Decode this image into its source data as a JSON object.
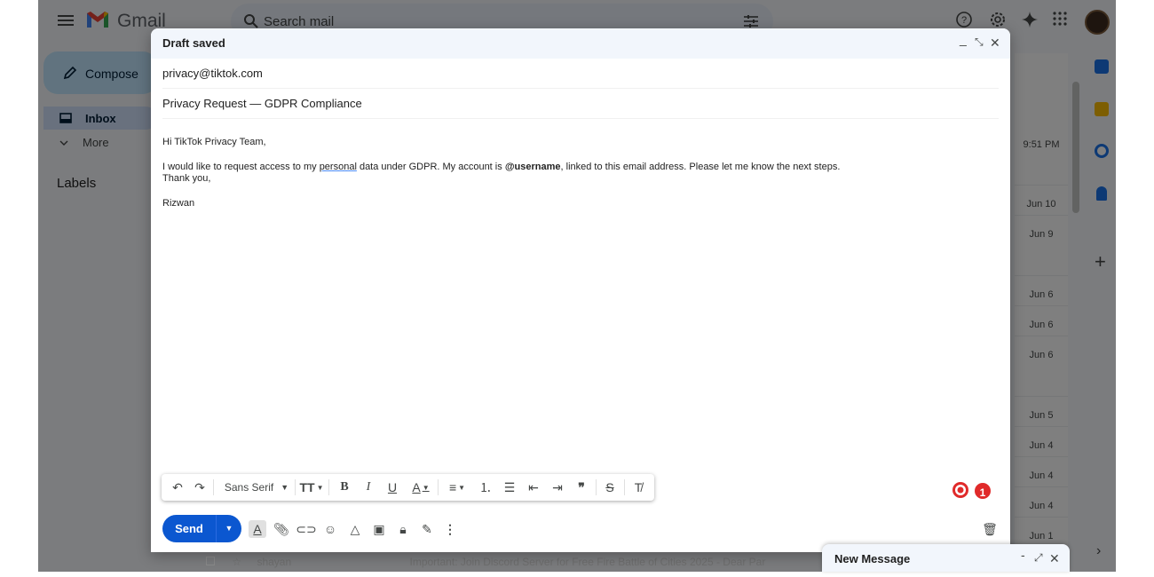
{
  "app": {
    "name": "Gmail"
  },
  "search": {
    "placeholder": "Search mail"
  },
  "nav": {
    "compose_label": "Compose",
    "inbox_label": "Inbox",
    "more_label": "More",
    "labels_heading": "Labels"
  },
  "list": {
    "dates": [
      "9:51 PM",
      "Jun 10",
      "Jun 9",
      "Jun 6",
      "Jun 6",
      "Jun 6",
      "Jun 5",
      "Jun 4",
      "Jun 4",
      "Jun 4",
      "Jun 1"
    ],
    "bottom_row": {
      "sender": "shayan",
      "subject": "Important: Join Discord Server for Free Fire Battle of Cities 2025 - Dear Par"
    }
  },
  "compose": {
    "status": "Draft saved",
    "to": "privacy@tiktok.com",
    "subject": "Privacy Request — GDPR Compliance",
    "body": {
      "greeting": "Hi TikTok Privacy Team,",
      "line_prefix": "I would like to request access to my ",
      "line_spell_word": "personal",
      "line_mid": " data under GDPR. My account is ",
      "line_bold": "@username",
      "line_suffix": ", linked to this email address. Please let me know the next steps.",
      "closing": "Thank you,",
      "signature": "Rizwan"
    },
    "format": {
      "font_name": "Sans Serif"
    },
    "send_label": "Send",
    "grammarly_count": "1"
  },
  "new_message": {
    "title": "New Message"
  },
  "colors": {
    "accent": "#0b57d0",
    "compose_button": "#c2e7ff",
    "inbox_highlight": "#d3e3fd",
    "overlay": "rgba(0,0,0,0.5)",
    "grammarly_red": "#e02a2a"
  },
  "icons": [
    "menu-icon",
    "gmail-logo-icon",
    "search-icon",
    "filter-options-icon",
    "help-icon",
    "settings-icon",
    "gemini-icon",
    "apps-grid-icon",
    "pencil-icon",
    "inbox-icon",
    "chevron-down-icon",
    "calendar-app-icon",
    "keep-app-icon",
    "tasks-app-icon",
    "contacts-app-icon",
    "plus-icon",
    "undo-icon",
    "redo-icon",
    "bold-icon",
    "italic-icon",
    "underline-icon",
    "attach-icon",
    "link-icon",
    "emoji-icon",
    "drive-icon",
    "photo-icon",
    "lock-icon",
    "signature-icon",
    "more-options-icon",
    "delete-icon",
    "grammarly-icon"
  ]
}
